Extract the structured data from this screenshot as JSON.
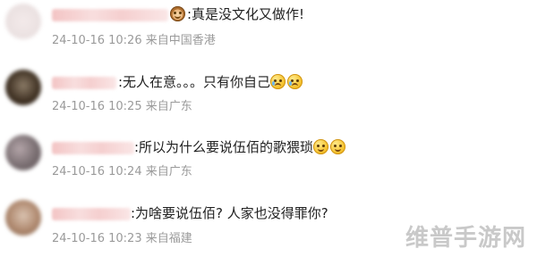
{
  "comments": [
    {
      "text": ":真是没文化又做作!",
      "emoji_before": "monkey-face-icon",
      "timestamp": "24-10-16 10:26",
      "location": "来自中国香港",
      "avatar_color": "#efe6e6"
    },
    {
      "text": ":无人在意。。。只有你自己",
      "emoji_after": [
        "crying-face-icon",
        "crying-face-icon"
      ],
      "timestamp": "24-10-16 10:25",
      "location": "来自广东",
      "avatar_color": "#4a3a2a"
    },
    {
      "text": ":所以为什么要说伍佰的歌猥琐",
      "emoji_after": [
        "smiling-face-icon",
        "smiling-face-icon"
      ],
      "timestamp": "24-10-16 10:24",
      "location": "来自广东",
      "avatar_color": "#7a6f72"
    },
    {
      "text": ":为啥要说伍佰? 人家也没得罪你?",
      "timestamp": "24-10-16 10:23",
      "location": "来自福建",
      "avatar_color": "#b08a70"
    }
  ],
  "watermark": "维普手游网"
}
